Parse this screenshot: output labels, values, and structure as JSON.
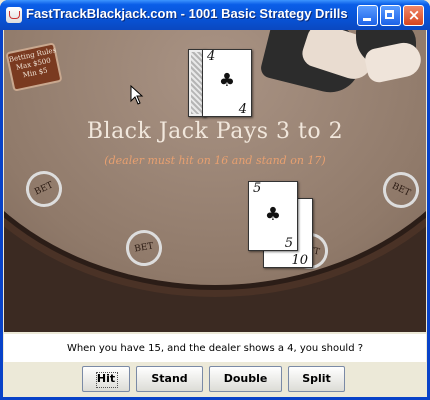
{
  "window": {
    "title": "FastTrackBlackjack.com - 1001 Basic Strategy Drills",
    "controls": {
      "minimize": "_",
      "maximize": "□",
      "close": "×"
    }
  },
  "table": {
    "sign": {
      "line1": "Betting Rules",
      "line2": "Max $500",
      "line3": "Min $5"
    },
    "headline": "Black Jack Pays 3 to 2",
    "subline": "(dealer must hit on 16 and stand on 17)",
    "bet_spots": [
      "BET",
      "BET",
      "BET",
      "BET"
    ],
    "dealer_card": {
      "rank": "4",
      "suit": "♣"
    },
    "player_cards": [
      {
        "rank": "5",
        "suit": "♣"
      },
      {
        "rank": "10",
        "suit": ""
      }
    ]
  },
  "question": "When you have 15, and the dealer shows a 4, you should ?",
  "buttons": {
    "hit": "Hit",
    "stand": "Stand",
    "double": "Double",
    "split": "Split"
  },
  "colors": {
    "title_bar": "#0853d6",
    "felt": "#a99384",
    "subline": "#e8a070"
  }
}
